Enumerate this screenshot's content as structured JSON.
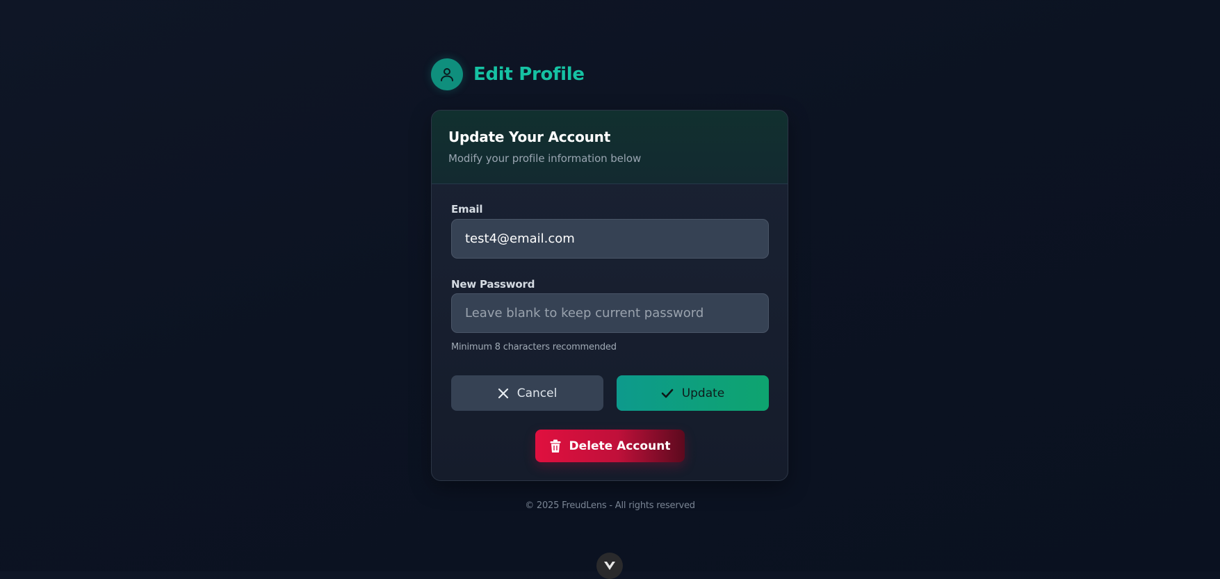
{
  "header": {
    "title": "Edit Profile",
    "avatar_icon": "user-icon"
  },
  "card": {
    "title": "Update Your Account",
    "subtitle": "Modify your profile information below"
  },
  "form": {
    "email_label": "Email",
    "email_value": "test4@email.com",
    "password_label": "New Password",
    "password_value": "",
    "password_placeholder": "Leave blank to keep current password",
    "password_hint": "Minimum 8 characters recommended"
  },
  "actions": {
    "cancel_label": "Cancel",
    "cancel_icon": "close-icon",
    "update_label": "Update",
    "update_icon": "check-icon",
    "delete_label": "Delete Account",
    "delete_icon": "trash-icon"
  },
  "footer": {
    "text": "© 2025 FreudLens - All rights reserved"
  },
  "scroll": {
    "icon": "chevron-down-icon"
  },
  "colors": {
    "accent": "#16c2a3",
    "danger": "#e0103f",
    "background": "#0c1322"
  }
}
